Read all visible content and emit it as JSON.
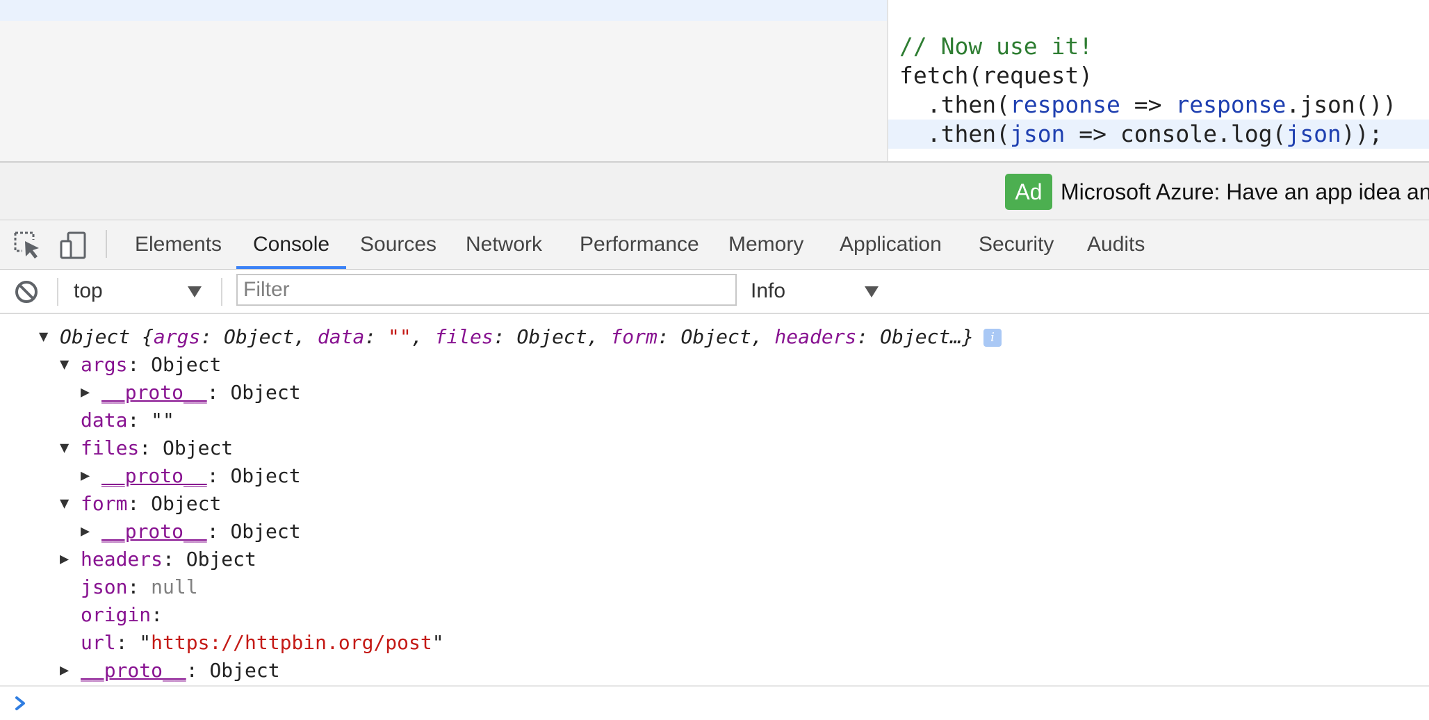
{
  "code": {
    "lines": [
      {
        "text": "// Now use it!"
      },
      {
        "text": "fetch(request)"
      },
      {
        "parts": [
          "  .then(",
          "response",
          " => ",
          "response",
          ".json())"
        ]
      },
      {
        "parts": [
          "  .then(",
          "json",
          " => console.log(",
          "json",
          "));"
        ]
      }
    ]
  },
  "ad": {
    "badge": "Ad",
    "text": "Microsoft Azure: Have an app idea an"
  },
  "devtools": {
    "tabs": [
      "Elements",
      "Console",
      "Sources",
      "Network",
      "Performance",
      "Memory",
      "Application",
      "Security",
      "Audits"
    ],
    "selected_tab": "Console",
    "icons": [
      "inspect-element-icon",
      "device-toolbar-icon"
    ]
  },
  "console_toolbar": {
    "context": "top",
    "filter_placeholder": "Filter",
    "level": "Info",
    "icons": [
      "clear-console-icon",
      "dropdown-arrow-icon"
    ]
  },
  "console_output": {
    "summary": {
      "prefix": "Object {",
      "items": [
        {
          "key": "args",
          "value": "Object"
        },
        {
          "key": "data",
          "value": "\"\""
        },
        {
          "key": "files",
          "value": "Object"
        },
        {
          "key": "form",
          "value": "Object"
        },
        {
          "key": "headers",
          "value": "Object…}"
        }
      ],
      "info_icon": "info-icon"
    },
    "tree": [
      {
        "key": "args",
        "value": "Object"
      },
      {
        "key": "__proto__",
        "value": "Object"
      },
      {
        "key": "data",
        "value": "\"\""
      },
      {
        "key": "files",
        "value": "Object"
      },
      {
        "key": "__proto__",
        "value": "Object"
      },
      {
        "key": "form",
        "value": "Object"
      },
      {
        "key": "__proto__",
        "value": "Object"
      },
      {
        "key": "headers",
        "value": "Object"
      },
      {
        "key": "json",
        "value": "null"
      },
      {
        "key": "origin",
        "value": ""
      },
      {
        "key": "url",
        "value": "https://httpbin.org/post"
      },
      {
        "key": "__proto__",
        "value": "Object"
      }
    ],
    "prompt_icon": "console-prompt-icon"
  },
  "colors": {
    "accent": "#3b82f6",
    "property_key": "#881391",
    "string": "#c41a16",
    "comment": "#2e7d32",
    "variable": "#1e3fb0",
    "ad_badge": "#4caf50"
  }
}
